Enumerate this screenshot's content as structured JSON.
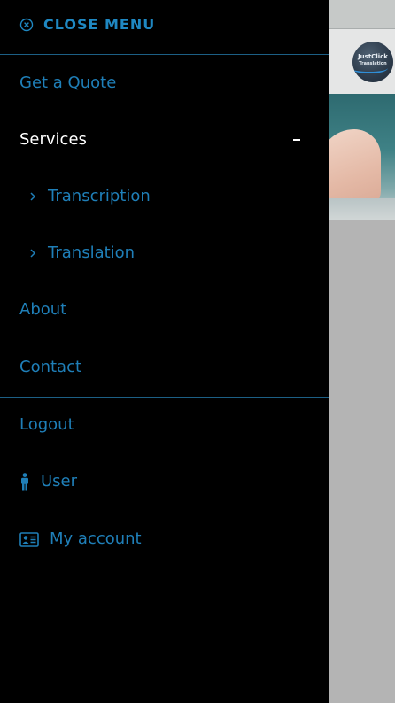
{
  "drawer": {
    "close_label": "CLOSE MENU",
    "accent_color": "#1f88c2",
    "items": [
      {
        "label": "Get a Quote"
      },
      {
        "label": "Services"
      },
      {
        "label": "Transcription"
      },
      {
        "label": "Translation"
      },
      {
        "label": "About"
      },
      {
        "label": "Contact"
      }
    ],
    "account_items": [
      {
        "label": "Logout"
      },
      {
        "label": "User",
        "icon": "user-icon"
      },
      {
        "label": "My account",
        "icon": "id-card-icon"
      }
    ]
  },
  "background_site": {
    "logo_text_line1": "JustClick",
    "logo_text_line2": "Translation"
  }
}
